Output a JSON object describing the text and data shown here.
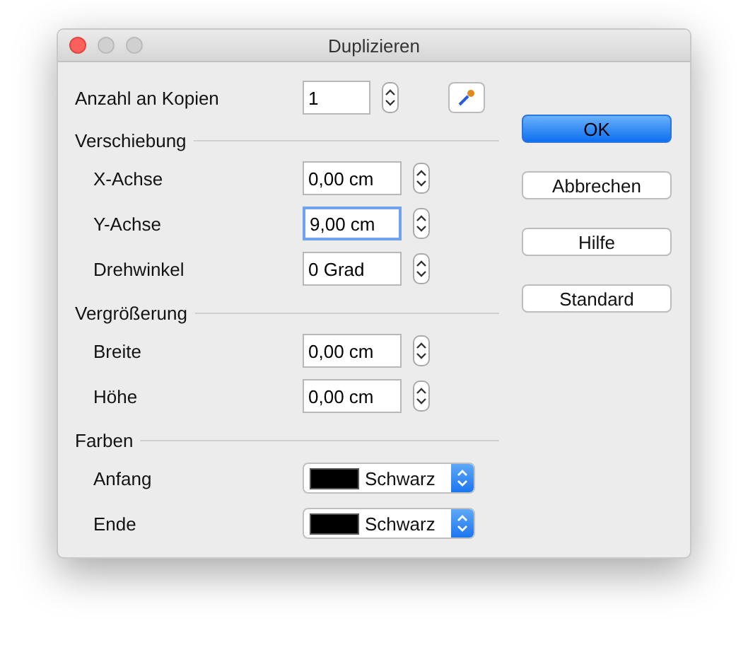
{
  "window": {
    "title": "Duplizieren"
  },
  "copies": {
    "label": "Anzahl an Kopien",
    "value": "1"
  },
  "sections": [
    {
      "title": "Verschiebung",
      "rows": [
        {
          "kind": "field",
          "label": "X-Achse",
          "value": "0,00 cm",
          "focused": false
        },
        {
          "kind": "field",
          "label": "Y-Achse",
          "value": "9,00 cm",
          "focused": true
        },
        {
          "kind": "field",
          "label": "Drehwinkel",
          "value": "0 Grad",
          "focused": false
        }
      ]
    },
    {
      "title": "Vergrößerung",
      "rows": [
        {
          "kind": "field",
          "label": "Breite",
          "value": "0,00 cm",
          "focused": false
        },
        {
          "kind": "field",
          "label": "Höhe",
          "value": "0,00 cm",
          "focused": false
        }
      ]
    },
    {
      "title": "Farben",
      "rows": [
        {
          "kind": "color",
          "label": "Anfang",
          "value": "Schwarz",
          "color": "#000000"
        },
        {
          "kind": "color",
          "label": "Ende",
          "value": "Schwarz",
          "color": "#000000"
        }
      ]
    }
  ],
  "buttons": [
    {
      "label": "OK",
      "selected": true
    },
    {
      "label": "Abbrechen",
      "selected": false
    },
    {
      "label": "Hilfe",
      "selected": false
    },
    {
      "label": "Standard",
      "selected": false
    }
  ]
}
